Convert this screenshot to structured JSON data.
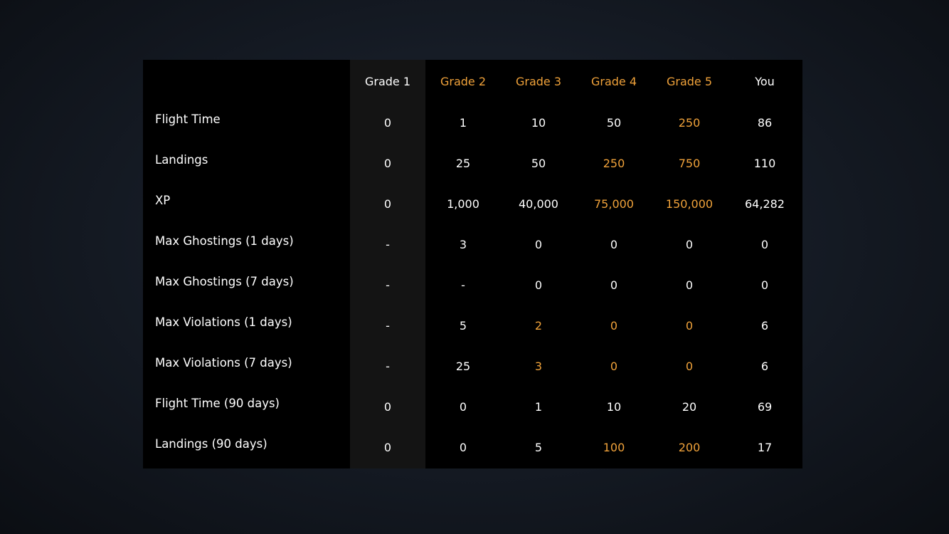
{
  "columns": [
    {
      "label": "Grade 1",
      "color": "#ffffff"
    },
    {
      "label": "Grade 2",
      "color": "#f0a23a"
    },
    {
      "label": "Grade 3",
      "color": "#f0a23a"
    },
    {
      "label": "Grade 4",
      "color": "#f0a23a"
    },
    {
      "label": "Grade 5",
      "color": "#f0a23a"
    },
    {
      "label": "You",
      "color": "#ffffff"
    }
  ],
  "rows": [
    {
      "label": "Flight Time",
      "values": [
        {
          "text": "0",
          "hl": false
        },
        {
          "text": "1",
          "hl": false
        },
        {
          "text": "10",
          "hl": false
        },
        {
          "text": "50",
          "hl": false
        },
        {
          "text": "250",
          "hl": true
        },
        {
          "text": "86",
          "hl": false
        }
      ]
    },
    {
      "label": "Landings",
      "values": [
        {
          "text": "0",
          "hl": false
        },
        {
          "text": "25",
          "hl": false
        },
        {
          "text": "50",
          "hl": false
        },
        {
          "text": "250",
          "hl": true
        },
        {
          "text": "750",
          "hl": true
        },
        {
          "text": "110",
          "hl": false
        }
      ]
    },
    {
      "label": "XP",
      "values": [
        {
          "text": "0",
          "hl": false
        },
        {
          "text": "1,000",
          "hl": false
        },
        {
          "text": "40,000",
          "hl": false
        },
        {
          "text": "75,000",
          "hl": true
        },
        {
          "text": "150,000",
          "hl": true
        },
        {
          "text": "64,282",
          "hl": false
        }
      ]
    },
    {
      "label": "Max Ghostings (1 days)",
      "values": [
        {
          "text": "-",
          "hl": false
        },
        {
          "text": "3",
          "hl": false
        },
        {
          "text": "0",
          "hl": false
        },
        {
          "text": "0",
          "hl": false
        },
        {
          "text": "0",
          "hl": false
        },
        {
          "text": "0",
          "hl": false
        }
      ]
    },
    {
      "label": "Max Ghostings (7 days)",
      "values": [
        {
          "text": "-",
          "hl": false
        },
        {
          "text": "-",
          "hl": false
        },
        {
          "text": "0",
          "hl": false
        },
        {
          "text": "0",
          "hl": false
        },
        {
          "text": "0",
          "hl": false
        },
        {
          "text": "0",
          "hl": false
        }
      ]
    },
    {
      "label": "Max Violations (1 days)",
      "values": [
        {
          "text": "-",
          "hl": false
        },
        {
          "text": "5",
          "hl": false
        },
        {
          "text": "2",
          "hl": true
        },
        {
          "text": "0",
          "hl": true
        },
        {
          "text": "0",
          "hl": true
        },
        {
          "text": "6",
          "hl": false
        }
      ]
    },
    {
      "label": "Max Violations (7 days)",
      "values": [
        {
          "text": "-",
          "hl": false
        },
        {
          "text": "25",
          "hl": false
        },
        {
          "text": "3",
          "hl": true
        },
        {
          "text": "0",
          "hl": true
        },
        {
          "text": "0",
          "hl": true
        },
        {
          "text": "6",
          "hl": false
        }
      ]
    },
    {
      "label": "Flight Time (90 days)",
      "values": [
        {
          "text": "0",
          "hl": false
        },
        {
          "text": "0",
          "hl": false
        },
        {
          "text": "1",
          "hl": false
        },
        {
          "text": "10",
          "hl": false
        },
        {
          "text": "20",
          "hl": false
        },
        {
          "text": "69",
          "hl": false
        }
      ]
    },
    {
      "label": "Landings (90 days)",
      "values": [
        {
          "text": "0",
          "hl": false
        },
        {
          "text": "0",
          "hl": false
        },
        {
          "text": "5",
          "hl": false
        },
        {
          "text": "100",
          "hl": true
        },
        {
          "text": "200",
          "hl": true
        },
        {
          "text": "17",
          "hl": false
        }
      ]
    }
  ],
  "colors": {
    "highlight": "#f0a23a",
    "text": "#ffffff",
    "panel": "#000000",
    "grade1_column": "#141414"
  }
}
